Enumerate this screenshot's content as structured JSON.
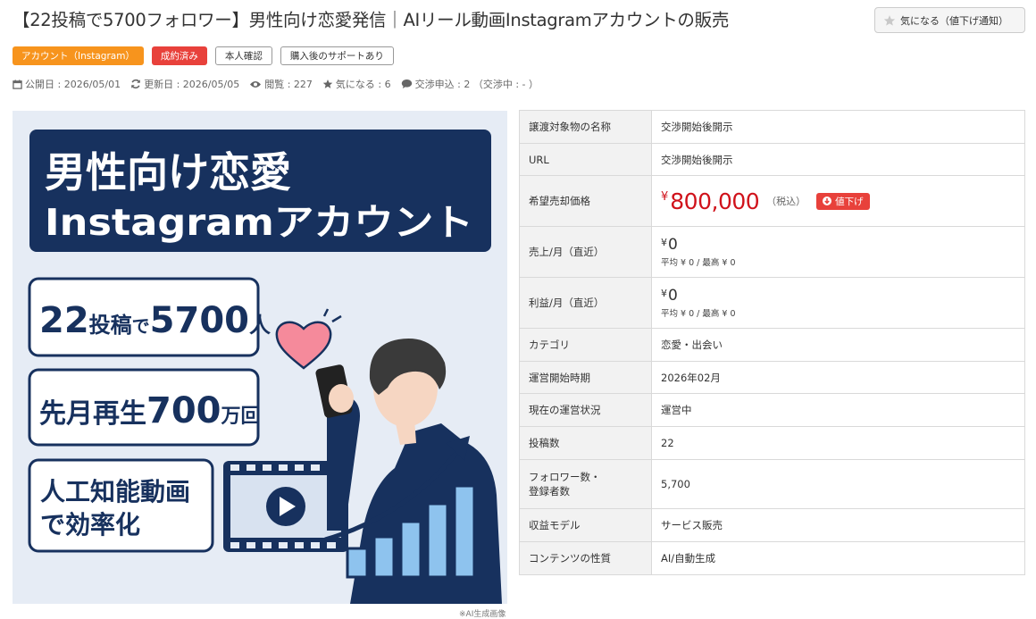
{
  "header": {
    "title": "【22投稿で5700フォロワー】男性向け恋愛発信｜AIリール動画Instagramアカウントの販売",
    "watch_button": "気になる（値下げ通知）"
  },
  "tags": [
    "アカウント（Instagram）",
    "成約済み",
    "本人確認",
    "購入後のサポートあり"
  ],
  "meta": {
    "published": "公開日 : 2026/05/01",
    "updated": "更新日 : 2026/05/05",
    "views": "閲覧 : 227",
    "likes": "気になる : 6",
    "offers": "交渉申込 : 2 （交渉中 : - ）"
  },
  "hero": {
    "title_line1": "男性向け恋愛",
    "title_line2": "Instagramアカウント",
    "box1_a": "22",
    "box1_b": "投稿",
    "box1_c": "で",
    "box1_d": "5700",
    "box1_e": "人",
    "box2_a": "先月再生",
    "box2_b": "700",
    "box2_c": "万回",
    "box3_line1": "人工知能動画",
    "box3_line2": "で効率化",
    "note": "※AI生成画像"
  },
  "details": {
    "name_label": "譲渡対象物の名称",
    "name_value": "交渉開始後開示",
    "url_label": "URL",
    "url_value": "交渉開始後開示",
    "price_label": "希望売却価格",
    "price_yen": "¥",
    "price_value": "800,000",
    "price_tax": "（税込）",
    "price_down": "値下げ",
    "sales_label": "売上/月（直近）",
    "sales_yen": "¥",
    "sales_value": "0",
    "sales_sub": "平均 ¥ 0 / 最高 ¥ 0",
    "profit_label": "利益/月（直近）",
    "profit_yen": "¥",
    "profit_value": "0",
    "profit_sub": "平均 ¥ 0 / 最高 ¥ 0",
    "category_label": "カテゴリ",
    "category_value": "恋愛・出会い",
    "start_label": "運営開始時期",
    "start_value": "2026年02月",
    "status_label": "現在の運営状況",
    "status_value": "運営中",
    "posts_label": "投稿数",
    "posts_value": "22",
    "followers_label_1": "フォロワー数・",
    "followers_label_2": "登録者数",
    "followers_value": "5,700",
    "revenue_label": "収益モデル",
    "revenue_value": "サービス販売",
    "content_label": "コンテンツの性質",
    "content_value": "AI/自動生成"
  },
  "colors": {
    "accent_orange": "#f7941d",
    "accent_red": "#e8413b",
    "price_red": "#d0121b",
    "hero_navy": "#17315e"
  }
}
